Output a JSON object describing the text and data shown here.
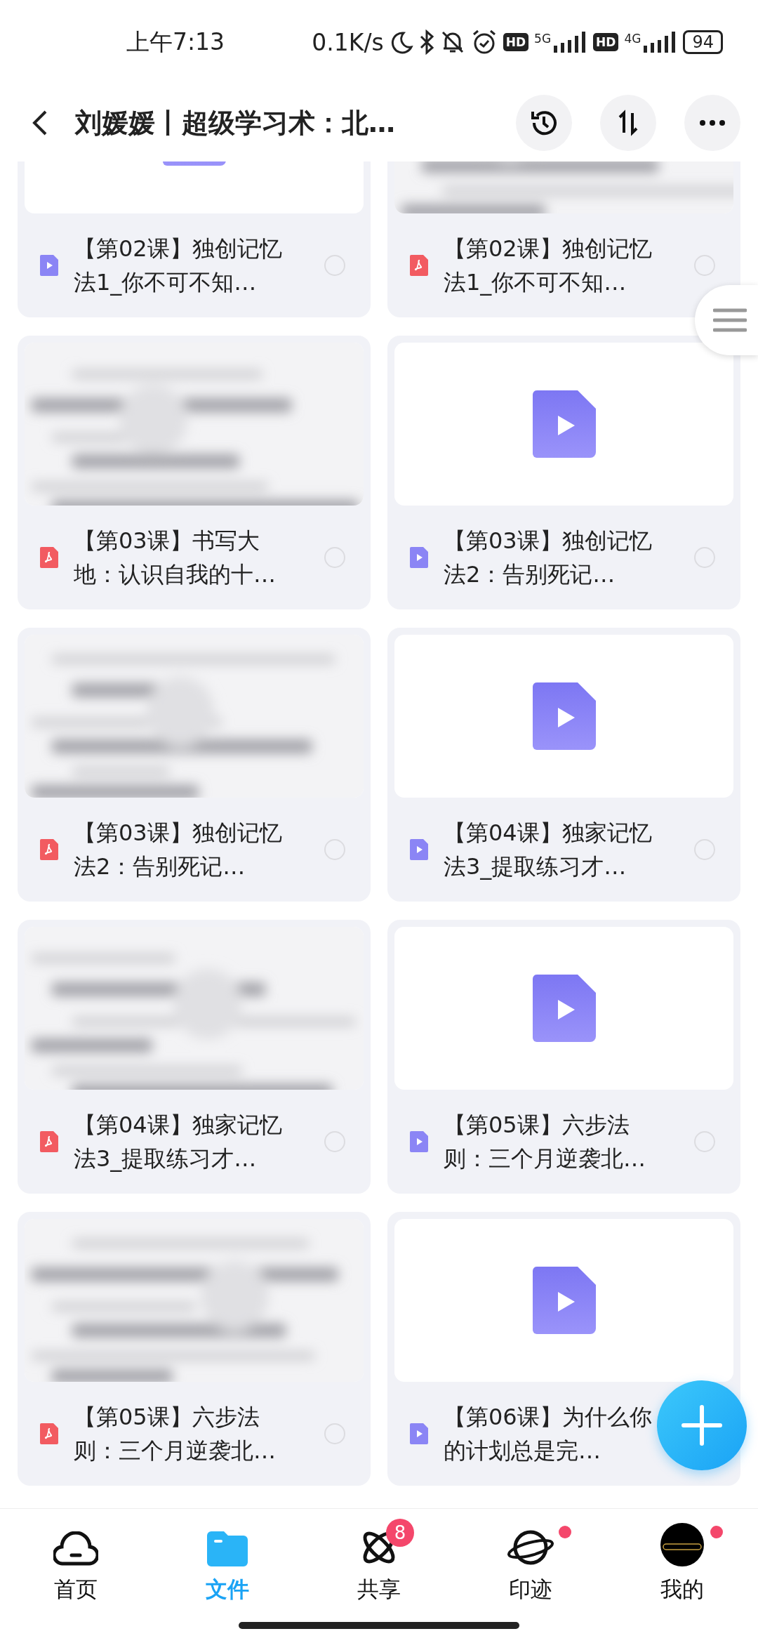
{
  "status_bar": {
    "time": "上午7:13",
    "net_speed": "0.1K/s",
    "sim1_hd": "HD",
    "sim1_network": "5G",
    "sim2_hd": "HD",
    "sim2_network": "4G",
    "battery": "94"
  },
  "header": {
    "title": "刘媛媛丨超级学习术：北…"
  },
  "files": [
    {
      "kind": "video",
      "title": "【第02课】独创记忆法1_你不可不知…",
      "selected": false
    },
    {
      "kind": "pdf",
      "title": "【第02课】独创记忆法1_你不可不知…",
      "selected": false
    },
    {
      "kind": "pdf",
      "title": "【第03课】书写大地：认识自我的十…",
      "selected": false
    },
    {
      "kind": "video",
      "title": "【第03课】独创记忆法2：告别死记…",
      "selected": false
    },
    {
      "kind": "pdf",
      "title": "【第03课】独创记忆法2：告别死记…",
      "selected": false
    },
    {
      "kind": "video",
      "title": "【第04课】独家记忆法3_提取练习才…",
      "selected": false
    },
    {
      "kind": "pdf",
      "title": "【第04课】独家记忆法3_提取练习才…",
      "selected": false
    },
    {
      "kind": "video",
      "title": "【第05课】六步法则：三个月逆袭北…",
      "selected": false
    },
    {
      "kind": "pdf",
      "title": "【第05课】六步法则：三个月逆袭北…",
      "selected": false
    },
    {
      "kind": "video",
      "title": "【第06课】为什么你的计划总是完…"
    }
  ],
  "nav": [
    {
      "kind": "home",
      "label": "首页",
      "selected": false,
      "dot": false
    },
    {
      "kind": "files",
      "label": "文件",
      "selected": true,
      "dot": false
    },
    {
      "kind": "share",
      "label": "共享",
      "selected": false,
      "dot": false,
      "badge": "8"
    },
    {
      "kind": "traces",
      "label": "印迹",
      "selected": false,
      "dot": true
    },
    {
      "kind": "me",
      "label": "我的",
      "selected": false,
      "dot": true
    }
  ]
}
